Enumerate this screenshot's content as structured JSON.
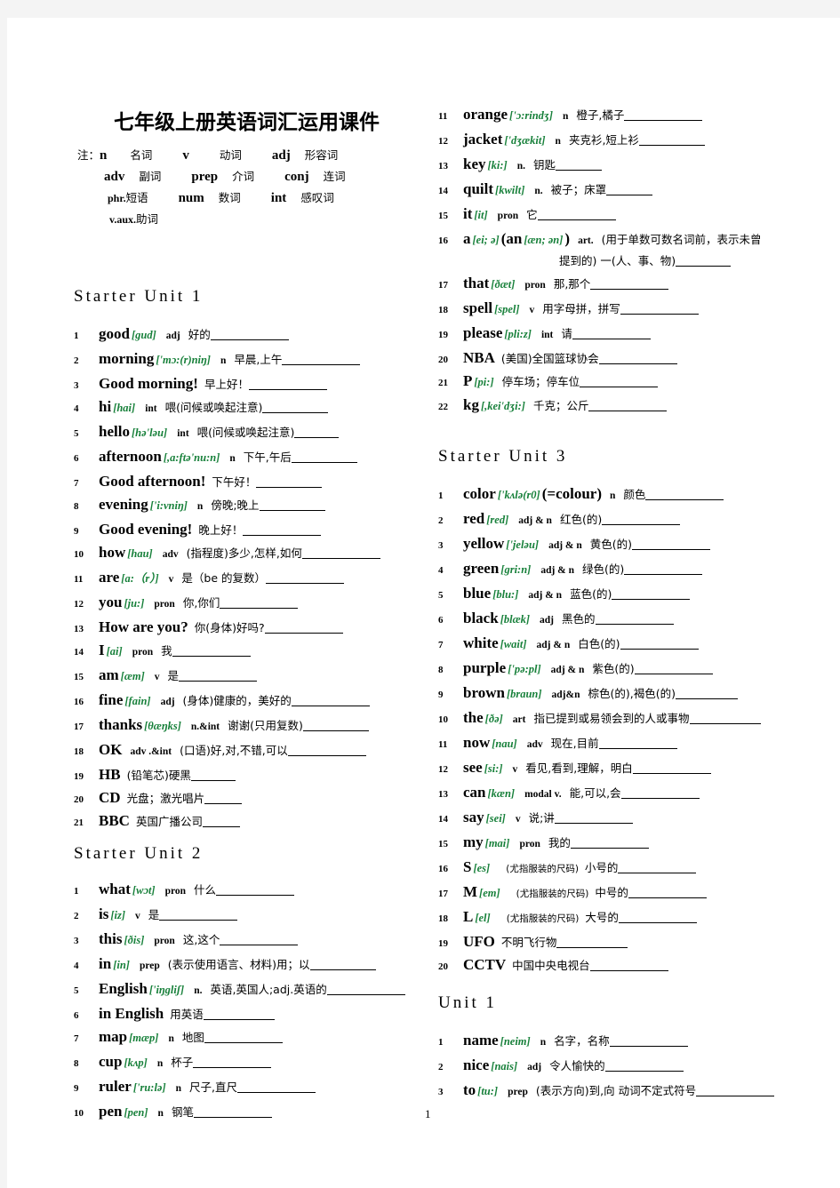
{
  "document": {
    "title": "七年级上册英语词汇运用课件",
    "page_number": "1",
    "accent_phonetic_color": "#17803a"
  },
  "legend": {
    "prefix": "注：",
    "rows": [
      [
        {
          "ab": "n",
          "cn": "名词"
        },
        {
          "ab": "v",
          "cn": "动词"
        },
        {
          "ab": "adj",
          "cn": "形容词"
        }
      ],
      [
        {
          "ab": "adv",
          "cn": "副词"
        },
        {
          "ab": "prep",
          "cn": "介词"
        },
        {
          "ab": "conj",
          "cn": "连词"
        }
      ],
      [
        {
          "ab": "phr.",
          "cn": "短语"
        },
        {
          "ab": "num",
          "cn": "数词"
        },
        {
          "ab": "int",
          "cn": "感叹词"
        }
      ],
      [
        {
          "ab": "v.aux.",
          "cn": "助词"
        }
      ]
    ]
  },
  "sections": {
    "starter_unit_1": {
      "heading": "Starter Unit 1",
      "items": [
        {
          "n": "1",
          "w": "good",
          "ph": "[gud]",
          "pos": "adj",
          "cn": "好的",
          "blank": 88
        },
        {
          "n": "2",
          "w": "morning",
          "ph": "['mɔ:(r)niŋ]",
          "pos": "n",
          "cn": "早晨,上午",
          "blank": 88
        },
        {
          "n": "3",
          "w": "Good  morning!",
          "ph": "",
          "pos": "",
          "cn": "早上好！",
          "blank": 88
        },
        {
          "n": "4",
          "w": "hi",
          "ph": "[hai]",
          "pos": "int",
          "cn": "喂(问候或唤起注意)",
          "blank": 74
        },
        {
          "n": "5",
          "w": "hello",
          "ph": "[hə'ləu]",
          "pos": "int",
          "cn": "喂(问候或唤起注意)",
          "blank": 50
        },
        {
          "n": "6",
          "w": "afternoon",
          "ph": "[,ɑ:ftə'nu:n]",
          "pos": "n",
          "cn": "下午,午后",
          "blank": 74
        },
        {
          "n": "7",
          "w": "Good afternoon!",
          "ph": "",
          "pos": "",
          "cn": "下午好！",
          "blank": 74
        },
        {
          "n": "8",
          "w": "evening",
          "ph": "['i:vniŋ]",
          "pos": "n",
          "cn": "傍晚;晚上",
          "blank": 74
        },
        {
          "n": "9",
          "w": "Good  evening!",
          "ph": "",
          "pos": "",
          "cn": "晚上好！",
          "blank": 88
        },
        {
          "n": "10",
          "w": "how",
          "ph": "[hau]",
          "pos": "adv",
          "cn": "(指程度)多少,怎样,如何",
          "blank": 88
        },
        {
          "n": "11",
          "w": "are",
          "ph": "[a:（r）]",
          "pos": "v",
          "cn": "是（be 的复数）",
          "blank": 88
        },
        {
          "n": "12",
          "w": "you",
          "ph": "[ju:]",
          "pos": "pron",
          "cn": "你,你们",
          "blank": 88
        },
        {
          "n": "13",
          "w": "How are you?",
          "ph": "",
          "pos": "",
          "cn": "你(身体)好吗?",
          "blank": 88
        },
        {
          "n": "14",
          "w": "I",
          "ph": "[ai]",
          "pos": "pron",
          "cn": "我",
          "blank": 88
        },
        {
          "n": "15",
          "w": "am",
          "ph": "[æm]",
          "pos": "v",
          "cn": "是",
          "blank": 88
        },
        {
          "n": "16",
          "w": "fine",
          "ph": "[fain]",
          "pos": "adj",
          "cn": "(身体)健康的，美好的",
          "blank": 88
        },
        {
          "n": "17",
          "w": "thanks",
          "ph": "[θæŋks]",
          "pos": "n.&int",
          "cn": "谢谢(只用复数)",
          "blank": 74
        },
        {
          "n": "18",
          "w": "OK",
          "ph": "",
          "pos": "adv .&int",
          "cn": "(口语)好,对,不错,可以",
          "blank": 88
        },
        {
          "n": "19",
          "w": "HB",
          "ph": "",
          "pos": "",
          "cn": "(铅笔芯)硬黑",
          "blank": 50
        },
        {
          "n": "20",
          "w": "CD",
          "ph": "",
          "pos": "",
          "cn": "光盘；激光唱片",
          "blank": 42
        },
        {
          "n": "21",
          "w": "BBC",
          "ph": "",
          "pos": "",
          "cn": "英国广播公司",
          "blank": 42
        }
      ]
    },
    "starter_unit_2": {
      "heading": "Starter Unit 2",
      "items": [
        {
          "n": "1",
          "w": "what",
          "ph": "[wɔt]",
          "pos": "pron",
          "cn": "什么",
          "blank": 88
        },
        {
          "n": "2",
          "w": "is",
          "ph": "[iz]",
          "pos": "v",
          "cn": "是",
          "blank": 88
        },
        {
          "n": "3",
          "w": "this",
          "ph": "[ðis]",
          "pos": "pron",
          "cn": "这,这个",
          "blank": 88
        },
        {
          "n": "4",
          "w": "in",
          "ph": "[in]",
          "pos": "prep",
          "cn": "(表示使用语言、材料)用；以",
          "blank": 74
        },
        {
          "n": "5",
          "w": "English",
          "ph": "['iŋgliʃ]",
          "pos": "n.",
          "cn": "英语,英国人;adj.英语的",
          "blank": 88
        },
        {
          "n": "6",
          "w": "in English",
          "ph": "",
          "pos": "",
          "cn": "用英语",
          "blank": 80
        },
        {
          "n": "7",
          "w": "map",
          "ph": "[mæp]",
          "pos": "n",
          "cn": "地图",
          "blank": 88
        },
        {
          "n": "8",
          "w": "cup",
          "ph": "[kʌp]",
          "pos": "n",
          "cn": "杯子",
          "blank": 88
        },
        {
          "n": "9",
          "w": "ruler",
          "ph": "['ru:lə]",
          "pos": "n",
          "cn": "尺子,直尺",
          "blank": 88
        },
        {
          "n": "10",
          "w": "pen",
          "ph": "[pen]",
          "pos": "n",
          "cn": "钢笔",
          "blank": 88
        }
      ]
    },
    "starter_unit_2_right": {
      "items": [
        {
          "n": "11",
          "w": "orange",
          "ph": "['ɔ:rindʒ]",
          "pos": "n",
          "cn": "橙子,橘子",
          "blank": 88
        },
        {
          "n": "12",
          "w": "jacket",
          "ph": "['dʒækit]",
          "pos": "n",
          "cn": "夹克衫,短上衫",
          "blank": 74
        },
        {
          "n": "13",
          "w": "key",
          "ph": "[ki:]",
          "pos": "n.",
          "cn": "钥匙",
          "blank": 52
        },
        {
          "n": "14",
          "w": "quilt",
          "ph": "[kwilt]",
          "pos": "n.",
          "cn": "被子；床罩",
          "blank": 52
        },
        {
          "n": "15",
          "w": "it",
          "ph": "[it]",
          "pos": "pron",
          "cn": "它",
          "blank": 88
        },
        {
          "n": "16",
          "w": "a",
          "ph": "[ei; ə]",
          "pos": "art.",
          "w2": "(an",
          "ph2": "[æn; ən]",
          "w2tail": ")",
          "cn": "(用于单数可数名词前，表示未曾",
          "cn_cont": "提到的)  一(人、事、物)",
          "blank": 62
        },
        {
          "n": "17",
          "w": "that",
          "ph": "[ðæt]",
          "pos": "pron",
          "cn": "那,那个",
          "blank": 88
        },
        {
          "n": "18",
          "w": "spell",
          "ph": "[spel]",
          "pos": "v",
          "cn": "用字母拼，拼写",
          "blank": 88
        },
        {
          "n": "19",
          "w": "please",
          "ph": "[pli:z]",
          "pos": "int",
          "cn": "请",
          "blank": 88
        },
        {
          "n": "20",
          "w": "NBA",
          "ph": "",
          "pos": "",
          "cn": "(美国)全国篮球协会",
          "blank": 88
        },
        {
          "n": "21",
          "w": "P",
          "ph": "[pi:]",
          "pos": "",
          "cn": "停车场；停车位",
          "blank": 88
        },
        {
          "n": "22",
          "w": "kg",
          "ph": "[,kei'dʒi:]",
          "pos": "",
          "cn": "千克；公斤",
          "blank": 88
        }
      ]
    },
    "starter_unit_3": {
      "heading": "Starter Unit 3",
      "items": [
        {
          "n": "1",
          "w": "color",
          "ph": "['kʌlə(r0]",
          "w2": "(=colour)",
          "pos": "n",
          "cn": "颜色",
          "blank": 88
        },
        {
          "n": "2",
          "w": "red",
          "ph": "[red]",
          "pos": "adj & n",
          "cn": "红色(的)",
          "blank": 88
        },
        {
          "n": "3",
          "w": "yellow",
          "ph": "['jeləu]",
          "pos": "adj & n",
          "cn": "黄色(的)",
          "blank": 88
        },
        {
          "n": "4",
          "w": "green",
          "ph": "[gri:n]",
          "pos": "adj & n",
          "cn": "绿色(的)",
          "blank": 88
        },
        {
          "n": "5",
          "w": "blue",
          "ph": "[blu:]",
          "pos": "adj & n",
          "cn": "蓝色(的)",
          "blank": 88
        },
        {
          "n": "6",
          "w": "black",
          "ph": "[blæk]",
          "pos": "adj",
          "cn": "黑色的",
          "blank": 88
        },
        {
          "n": "7",
          "w": "white",
          "ph": "[wait]",
          "pos": "adj & n",
          "cn": "白色(的)",
          "blank": 88
        },
        {
          "n": "8",
          "w": "purple",
          "ph": "['pə:pl]",
          "pos": "adj & n",
          "cn": "紫色(的)",
          "blank": 88
        },
        {
          "n": "9",
          "w": "brown",
          "ph": "[braun]",
          "pos": "adj&n",
          "cn": "棕色(的),褐色(的)",
          "blank": 70
        },
        {
          "n": "10",
          "w": "the",
          "ph": "[ðə]",
          "pos": "art",
          "cn": "指已提到或易领会到的人或事物",
          "blank": 80
        },
        {
          "n": "11",
          "w": "now",
          "ph": "[nau]",
          "pos": "adv",
          "cn": "现在,目前",
          "blank": 88
        },
        {
          "n": "12",
          "w": "see",
          "ph": "[si:]",
          "pos": "v",
          "cn": "看见,看到,理解，明白",
          "blank": 88
        },
        {
          "n": "13",
          "w": "can",
          "ph": "[kæn]",
          "pos": "modal v.",
          "cn": "能,可以,会",
          "blank": 88
        },
        {
          "n": "14",
          "w": "say",
          "ph": "[sei]",
          "pos": "v",
          "cn": "说;讲",
          "blank": 88
        },
        {
          "n": "15",
          "w": "my",
          "ph": "[mai]",
          "pos": "pron",
          "cn": "我的",
          "blank": 88
        },
        {
          "n": "16",
          "w": "S",
          "ph": "[es]",
          "pos": "",
          "cn_sm": "(尤指服装的尺码)",
          "cn": "小号的",
          "blank": 88
        },
        {
          "n": "17",
          "w": "M",
          "ph": "[em]",
          "pos": "",
          "cn_sm": "(尤指服装的尺码)",
          "cn": "中号的",
          "blank": 88
        },
        {
          "n": "18",
          "w": "L",
          "ph": "[el]",
          "pos": "",
          "cn_sm": "(尤指服装的尺码)",
          "cn": "大号的",
          "blank": 88
        },
        {
          "n": "19",
          "w": "UFO",
          "ph": "",
          "pos": "",
          "cn": "不明飞行物",
          "blank": 80
        },
        {
          "n": "20",
          "w": "CCTV",
          "ph": "",
          "pos": "",
          "cn": "中国中央电视台",
          "blank": 88
        }
      ]
    },
    "unit_1": {
      "heading": "Unit 1",
      "items": [
        {
          "n": "1",
          "w": "name",
          "ph": "[neim]",
          "pos": "n",
          "cn": "名字，名称",
          "blank": 88
        },
        {
          "n": "2",
          "w": "nice",
          "ph": "[nais]",
          "pos": "adj",
          "cn": "令人愉快的",
          "blank": 88
        },
        {
          "n": "3",
          "w": "to",
          "ph": "[tu:]",
          "pos": "prep",
          "cn": "(表示方向)到,向  动词不定式符号",
          "blank": 88
        }
      ]
    }
  }
}
